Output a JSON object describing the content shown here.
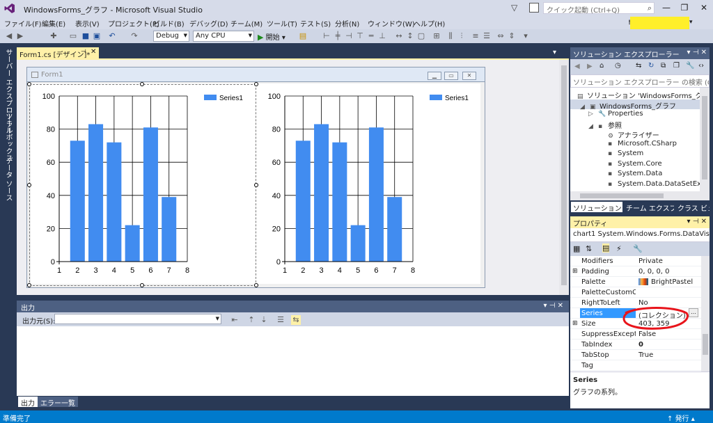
{
  "window": {
    "title": "WindowsForms_グラフ - Microsoft Visual Studio",
    "quick_launch_placeholder": "クイック起動 (Ctrl+Q)",
    "controls": [
      "—",
      "❐",
      "✕"
    ]
  },
  "menu": [
    "ファイル(F)",
    "編集(E)",
    "表示(V)",
    "プロジェクト(P)",
    "ビルド(B)",
    "デバッグ(D)",
    "チーム(M)",
    "ツール(T)",
    "テスト(S)",
    "分析(N)",
    "ウィンドウ(W)",
    "ヘルプ(H)"
  ],
  "toolbar": {
    "config": "Debug",
    "platform": "Any CPU",
    "start_label": "開始"
  },
  "left_strip": [
    "サーバー エクスプローラー",
    "ツールボックス",
    "データ ソース"
  ],
  "document_tab": {
    "label": "Form1.cs [デザイン]*"
  },
  "form": {
    "title": "Form1"
  },
  "charts": [
    {
      "legend": "Series1"
    },
    {
      "legend": "Series1"
    }
  ],
  "chart_data": [
    {
      "type": "bar",
      "x": [
        2,
        3,
        4,
        5,
        6,
        7
      ],
      "series": [
        {
          "name": "Series1",
          "values": [
            73,
            83,
            72,
            22,
            81,
            39
          ]
        }
      ],
      "xlim": [
        1,
        8
      ],
      "ylim": [
        0,
        100
      ],
      "xticks": [
        1,
        2,
        3,
        4,
        5,
        6,
        7,
        8
      ],
      "yticks": [
        0,
        20,
        40,
        60,
        80,
        100
      ],
      "grid": true,
      "legend_position": "top-right",
      "bar_color": "#418cf0"
    },
    {
      "type": "bar",
      "x": [
        2,
        3,
        4,
        5,
        6,
        7
      ],
      "series": [
        {
          "name": "Series1",
          "values": [
            73,
            83,
            72,
            22,
            81,
            39
          ]
        }
      ],
      "xlim": [
        1,
        8
      ],
      "ylim": [
        0,
        100
      ],
      "xticks": [
        1,
        2,
        3,
        4,
        5,
        6,
        7,
        8
      ],
      "yticks": [
        0,
        20,
        40,
        60,
        80,
        100
      ],
      "grid": true,
      "legend_position": "top-right",
      "bar_color": "#418cf0"
    }
  ],
  "output": {
    "title": "出力",
    "source_label": "出力元(S):",
    "tabs": [
      "出力",
      "エラー一覧"
    ]
  },
  "status": {
    "text": "準備完了",
    "publish": "発行"
  },
  "solution_explorer": {
    "title": "ソリューション エクスプローラー",
    "search_placeholder": "ソリューション エクスプローラー の検索 (Ctrl+;)",
    "tree": [
      {
        "label": "ソリューション 'WindowsForms_グラフ' (1 プロジェクト)",
        "icon": "solution-icon"
      },
      {
        "label": "WindowsForms_グラフ",
        "icon": "csharp-project-icon"
      },
      {
        "label": "Properties",
        "icon": "wrench-icon"
      },
      {
        "label": "参照",
        "icon": "references-icon"
      },
      {
        "label": "アナライザー",
        "icon": "analyzer-icon"
      },
      {
        "label": "Microsoft.CSharp",
        "icon": "assembly-icon"
      },
      {
        "label": "System",
        "icon": "assembly-icon"
      },
      {
        "label": "System.Core",
        "icon": "assembly-icon"
      },
      {
        "label": "System.Data",
        "icon": "assembly-icon"
      },
      {
        "label": "System.Data.DataSetExtensions",
        "icon": "assembly-icon"
      }
    ],
    "tabs": [
      "ソリューション エ...",
      "チーム エクスプロ...",
      "クラス ビュー"
    ]
  },
  "properties": {
    "title": "プロパティ",
    "object": "chart1  System.Windows.Forms.DataVisualization.Charting.Chart",
    "rows": [
      {
        "name": "Modifiers",
        "value": "Private"
      },
      {
        "name": "Padding",
        "value": "0, 0, 0, 0"
      },
      {
        "name": "Palette",
        "value": "BrightPastel"
      },
      {
        "name": "PaletteCustomColors",
        "value": ""
      },
      {
        "name": "RightToLeft",
        "value": "No"
      },
      {
        "name": "Series",
        "value": "(コレクション)"
      },
      {
        "name": "Size",
        "value": "403, 359"
      },
      {
        "name": "SuppressExceptions",
        "value": "False"
      },
      {
        "name": "TabIndex",
        "value": "0"
      },
      {
        "name": "TabStop",
        "value": "True"
      },
      {
        "name": "Tag",
        "value": ""
      }
    ],
    "description_title": "Series",
    "description_text": "グラフの系列。"
  }
}
